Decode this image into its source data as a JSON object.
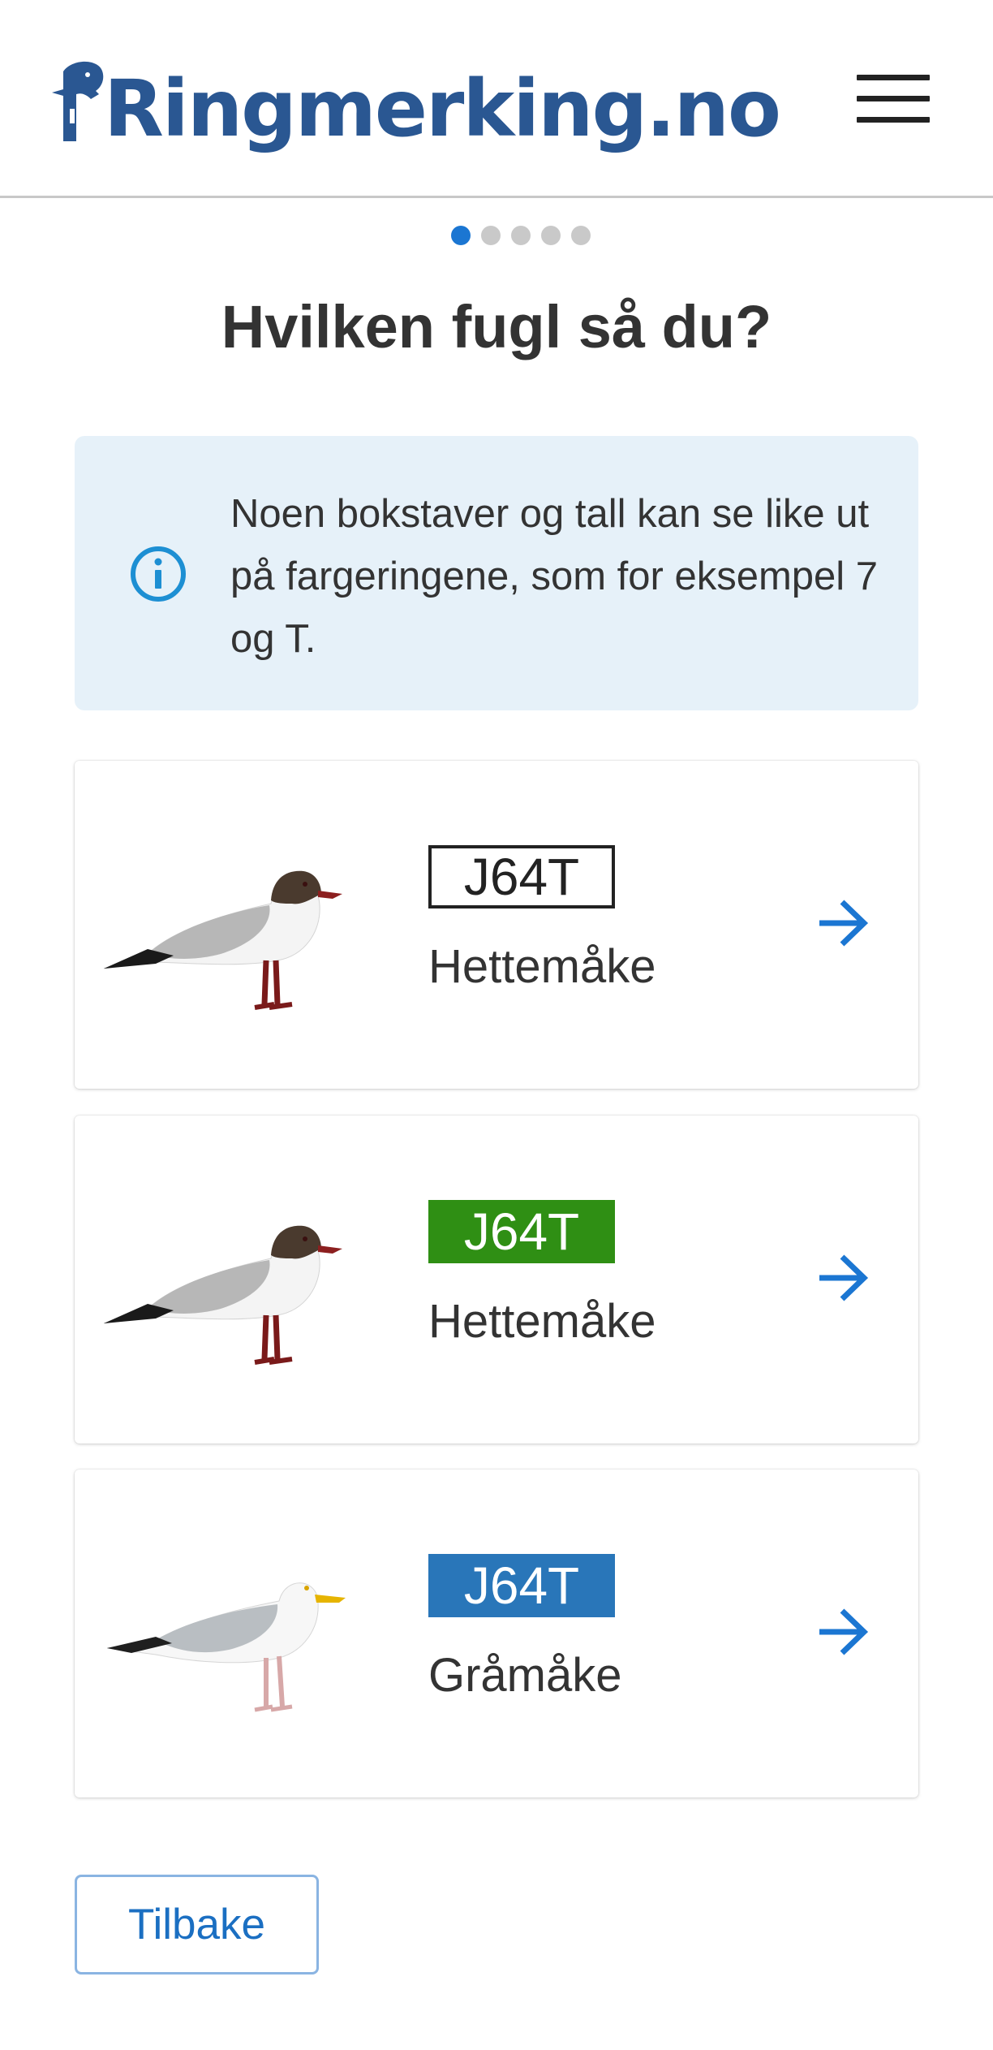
{
  "header": {
    "logo_text": "Ringmerking.no",
    "menu_icon": "hamburger-menu-icon"
  },
  "progress": {
    "current_step": 1,
    "total_steps": 5
  },
  "page_title": "Hvilken fugl så du?",
  "info": {
    "icon": "info-icon",
    "text": "Noen bokstaver og tall kan se like ut på fargeringene, som for eksempel 7 og T."
  },
  "results": [
    {
      "code": "J64T",
      "ring_color": "#ffffff",
      "ring_style": "outline",
      "species": "Hettemåke",
      "bird_icon": "black-headed-gull-image",
      "arrow_icon": "arrow-right-icon"
    },
    {
      "code": "J64T",
      "ring_color": "#2f8f14",
      "ring_style": "green",
      "species": "Hettemåke",
      "bird_icon": "black-headed-gull-image",
      "arrow_icon": "arrow-right-icon"
    },
    {
      "code": "J64T",
      "ring_color": "#2976b9",
      "ring_style": "blue",
      "species": "Gråmåke",
      "bird_icon": "herring-gull-image",
      "arrow_icon": "arrow-right-icon"
    }
  ],
  "back_button_label": "Tilbake",
  "colors": {
    "primary": "#1b76d2",
    "logo": "#2a5792",
    "info_bg": "#e6f1f9"
  }
}
